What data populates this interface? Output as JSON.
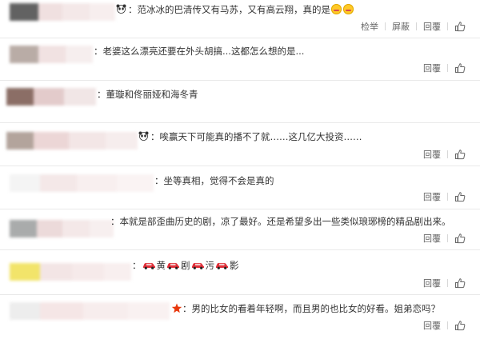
{
  "comments": [
    {
      "text": "：范冰冰的巴清传又有马苏，又有高云翔，真的是",
      "has_panda": true,
      "emoji_count": 2,
      "actions": {
        "report": "检举",
        "block": "屏蔽",
        "reply": "回覆"
      }
    },
    {
      "text": "：老婆这么漂亮还要在外头胡搞...这都怎么想的是...",
      "actions": {
        "reply": "回覆"
      }
    },
    {
      "text": "：董璇和佟丽娅和海冬青",
      "actions": {
        "reply": "回覆"
      }
    },
    {
      "text": "：唉赢天下可能真的播不了就……这几亿大投资……",
      "has_panda": true,
      "actions": {
        "reply": "回覆"
      }
    },
    {
      "text": "：坐等真相，觉得不会是真的",
      "actions": {
        "reply": "回覆"
      }
    },
    {
      "text": "：本就是部歪曲历史的剧，凉了最好。还是希望多出一些类似琅琊榜的精品剧出来。",
      "actions": {
        "reply": "回覆"
      }
    },
    {
      "segments": [
        "：",
        "黄",
        "剧",
        "污",
        "影"
      ],
      "actions": {
        "reply": "回覆"
      }
    },
    {
      "text": "：男的比女的看着年轻啊，而且男的也比女的好看。姐弟恋吗？",
      "has_star": true,
      "actions": {
        "reply": "回覆"
      }
    }
  ],
  "colors": {
    "text": "#333333",
    "action_text": "#666666",
    "divider": "#e9e9e9",
    "car": "#e0303a",
    "star": "#e8380d"
  },
  "icons": [
    "panda-icon",
    "grin-emoji-icon",
    "red-car-icon",
    "thumbs-up-icon",
    "star-icon"
  ]
}
